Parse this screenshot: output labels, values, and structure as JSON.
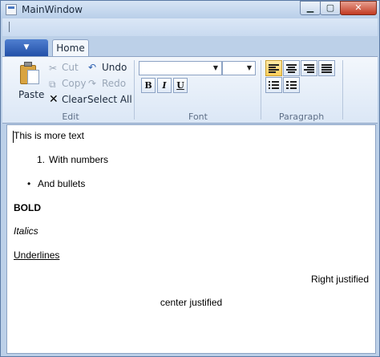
{
  "window": {
    "title": "MainWindow"
  },
  "ribbon": {
    "tabs": [
      {
        "label": "Home"
      }
    ],
    "groups": {
      "edit": {
        "label": "Edit",
        "paste": "Paste",
        "cut": "Cut",
        "copy": "Copy",
        "clear": "Clear",
        "undo": "Undo",
        "redo": "Redo",
        "select_all": "Select All"
      },
      "font": {
        "label": "Font",
        "font_family_value": "",
        "font_size_value": "",
        "bold": "B",
        "italic": "I",
        "underline": "U"
      },
      "paragraph": {
        "label": "Paragraph"
      }
    }
  },
  "document": {
    "line1": "This is more text",
    "numbered_marker": "1.",
    "numbered_item": "With numbers",
    "bullet_marker": "•",
    "bullet_item": "And bullets",
    "bold": "BOLD",
    "italic": "Italics",
    "underline": "Underlines",
    "right": "Right justified",
    "center": "center justified"
  }
}
